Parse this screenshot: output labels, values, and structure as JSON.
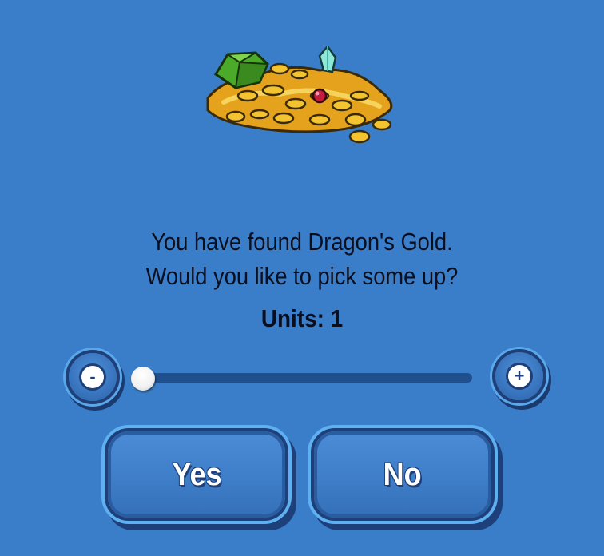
{
  "dialog": {
    "message_line1": "You have found Dragon's Gold.",
    "message_line2": "Would you like to pick some up?",
    "units_label": "Units: 1",
    "units_value": 1,
    "minus_label": "-",
    "plus_label": "+",
    "yes_label": "Yes",
    "no_label": "No"
  },
  "icons": {
    "treasure": "dragon-gold-treasure-pile-icon",
    "minus": "minus-icon",
    "plus": "plus-icon"
  },
  "colors": {
    "background": "#3a7ec9",
    "button_border": "#1d3f7a",
    "button_glow": "#5fb0f0",
    "slider_track": "#1f4f8c",
    "text": "#0a0f1f"
  }
}
